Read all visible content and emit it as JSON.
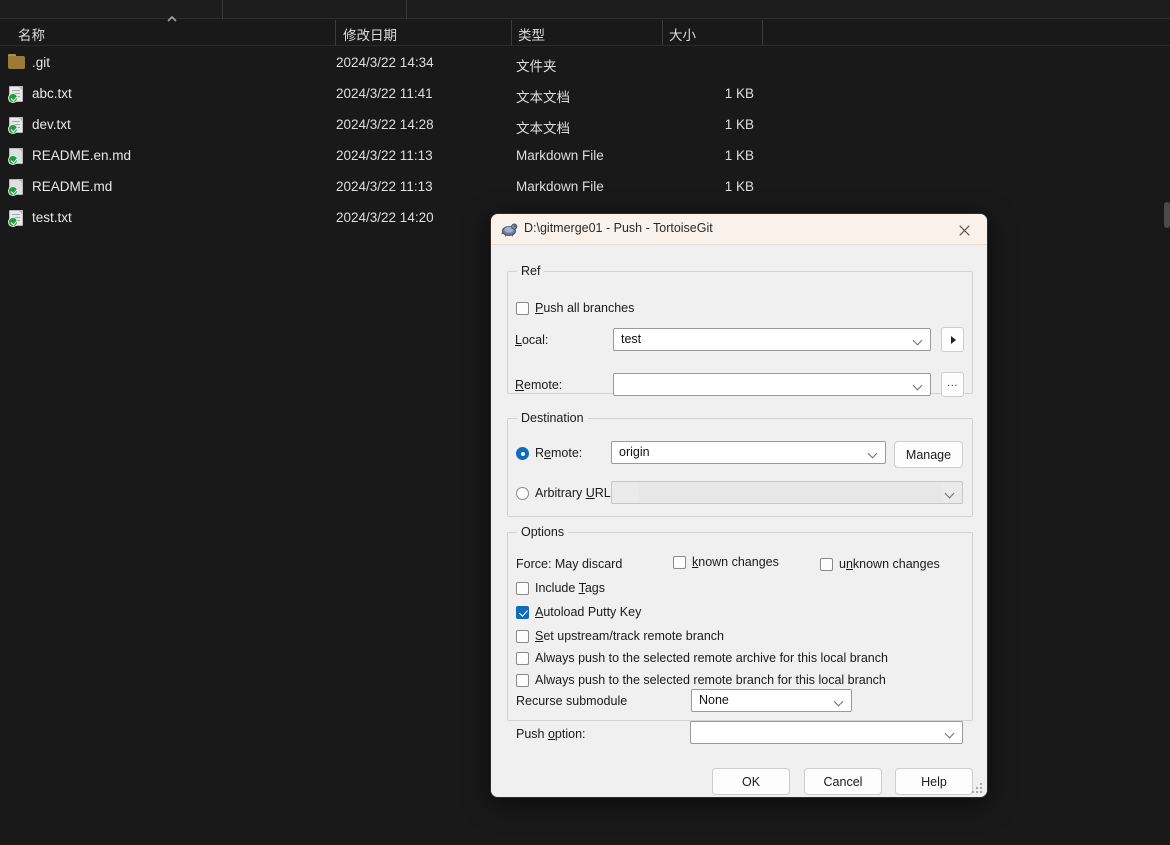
{
  "explorer": {
    "columns": [
      {
        "label": "名称",
        "key": "name"
      },
      {
        "label": "修改日期",
        "key": "date"
      },
      {
        "label": "类型",
        "key": "type"
      },
      {
        "label": "大小",
        "key": "size"
      }
    ],
    "sort_indicator": "ascending-caret",
    "files": [
      {
        "name": ".git",
        "date": "2024/3/22 14:34",
        "type": "文件夹",
        "size": "",
        "icon": "folder-icon"
      },
      {
        "name": "abc.txt",
        "date": "2024/3/22 11:41",
        "type": "文本文档",
        "size": "1 KB",
        "icon": "text-document-icon"
      },
      {
        "name": "dev.txt",
        "date": "2024/3/22 14:28",
        "type": "文本文档",
        "size": "1 KB",
        "icon": "text-document-icon"
      },
      {
        "name": "README.en.md",
        "date": "2024/3/22 11:13",
        "type": "Markdown File",
        "size": "1 KB",
        "icon": "markdown-document-icon"
      },
      {
        "name": "README.md",
        "date": "2024/3/22 11:13",
        "type": "Markdown File",
        "size": "1 KB",
        "icon": "markdown-document-icon"
      },
      {
        "name": "test.txt",
        "date": "2024/3/22 14:20",
        "type": "",
        "size": "",
        "icon": "text-document-icon"
      }
    ]
  },
  "dialog": {
    "title": "D:\\gitmerge01 - Push - TortoiseGit",
    "app_icon": "tortoisegit-icon",
    "close_label": "✕",
    "ref": {
      "legend": "Ref",
      "push_all_branches": {
        "label": "Push all branches",
        "checked": false
      },
      "local": {
        "label": "Local:",
        "value": "test"
      },
      "remote": {
        "label": "Remote:",
        "value": ""
      },
      "local_browse_button": "▶",
      "remote_browse_button": "..."
    },
    "destination": {
      "legend": "Destination",
      "mode": "remote",
      "remote": {
        "label": "Remote:",
        "value": "origin"
      },
      "arbitrary_url": {
        "label": "Arbitrary URL:",
        "value": "",
        "enabled": false
      },
      "manage_button": "Manage"
    },
    "options": {
      "legend": "Options",
      "force_label": "Force: May discard",
      "force_known": {
        "label": "known changes",
        "checked": false
      },
      "force_unknown": {
        "label": "unknown changes",
        "checked": false
      },
      "include_tags": {
        "label": "Include Tags",
        "checked": false
      },
      "autoload_putty_key": {
        "label": "Autoload Putty Key",
        "checked": true
      },
      "set_upstream": {
        "label": "Set upstream/track remote branch",
        "checked": false
      },
      "always_push_archive": {
        "label": "Always push to the selected remote archive for this local branch",
        "checked": false
      },
      "always_push_branch": {
        "label": "Always push to the selected remote branch for this local branch",
        "checked": false
      },
      "recurse_submodule": {
        "label": "Recurse submodule",
        "value": "None"
      },
      "push_option": {
        "label": "Push option:",
        "value": ""
      }
    },
    "buttons": {
      "ok": "OK",
      "cancel": "Cancel",
      "help": "Help"
    }
  },
  "colors": {
    "accent": "#0f6cbd",
    "titlebar": "#faf1ea",
    "dialog_bg": "#f0f0f0",
    "explorer_bg": "#191919",
    "folder": "#9c7b38",
    "status_ok": "#1f9e3e"
  }
}
